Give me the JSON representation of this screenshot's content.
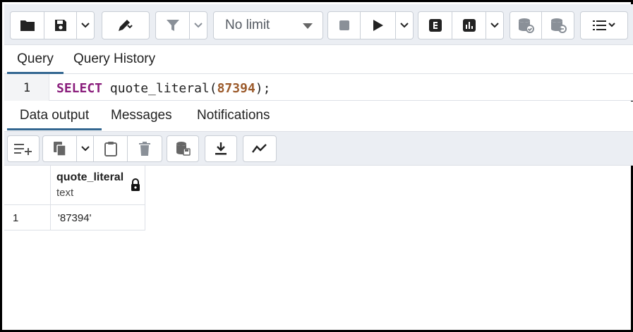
{
  "toolbar": {
    "limit_label": "No limit"
  },
  "query_tabs": [
    {
      "label": "Query",
      "active": true
    },
    {
      "label": "Query History",
      "active": false
    }
  ],
  "editor": {
    "line_number": "1",
    "keyword": "SELECT",
    "func": " quote_literal(",
    "arg": "87394",
    "tail": ");"
  },
  "output_tabs": [
    {
      "label": "Data output",
      "active": true
    },
    {
      "label": "Messages",
      "active": false
    },
    {
      "label": "Notifications",
      "active": false
    }
  ],
  "result": {
    "columns": [
      {
        "name": "quote_literal",
        "type": "text",
        "locked": true
      }
    ],
    "rows": [
      {
        "num": "1",
        "cells": [
          "'87394'"
        ]
      }
    ]
  },
  "colors": {
    "accent": "#326690",
    "keyword": "#8a1e7c",
    "number": "#9c5b2c",
    "toolbar_bg": "#ebeef3"
  }
}
